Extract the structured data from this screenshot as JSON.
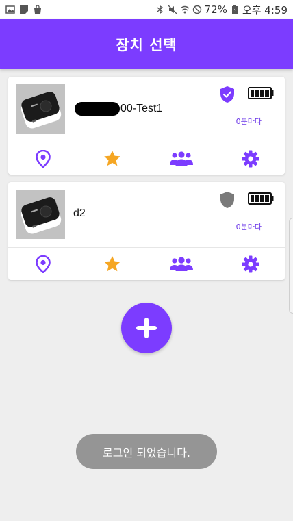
{
  "status_bar": {
    "battery_percent": "72%",
    "time": "오후 4:59",
    "left_icons": [
      "image-icon",
      "note-icon",
      "shopping-bag-icon"
    ],
    "right_icons": [
      "bluetooth-icon",
      "mute-icon",
      "wifi-icon",
      "do-not-disturb-icon",
      "battery-charging-icon"
    ]
  },
  "app_bar": {
    "title": "장치 선택",
    "color": "#7c3cff"
  },
  "devices": [
    {
      "name": "I●●●●00-Test1",
      "name_visible": "00-Test1",
      "shield_state": "verified",
      "shield_color": "#7c3cff",
      "battery": "full",
      "interval": "0분마다"
    },
    {
      "name": "d2",
      "shield_state": "unverified",
      "shield_color": "#7a7a7a",
      "battery": "full",
      "interval": "0분마다"
    }
  ],
  "card_actions": [
    {
      "icon": "location-pin-icon",
      "color": "#7c3cff"
    },
    {
      "icon": "star-icon",
      "color": "#f5a623"
    },
    {
      "icon": "group-icon",
      "color": "#7c3cff"
    },
    {
      "icon": "settings-gear-icon",
      "color": "#7c3cff"
    }
  ],
  "fab": {
    "icon": "plus-icon",
    "color": "#7c3cff"
  },
  "toast": {
    "message": "로그인 되었습니다."
  }
}
